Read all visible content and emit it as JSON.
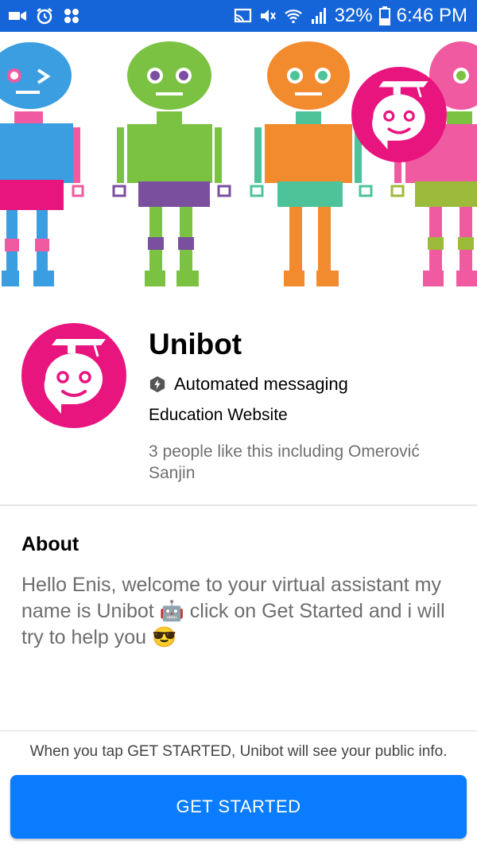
{
  "status_bar": {
    "battery": "32%",
    "time": "6:46 PM",
    "bg_color": "#1565d8"
  },
  "page": {
    "name": "Unibot",
    "verified_label": "Automated messaging",
    "category": "Education Website",
    "likes": "3 people like this including Omerović Sanjin"
  },
  "about": {
    "title": "About",
    "text": "Hello Enis, welcome to your virtual assistant my name is Unibot 🤖 click on  Get Started and i will try to help you 😎"
  },
  "footer": {
    "note": "When you tap GET STARTED, Unibot will see your public info.",
    "button_label": "GET STARTED",
    "button_color": "#0a7cff"
  },
  "colors": {
    "brand_pink": "#e8157f",
    "robot_blue": "#3b9ee0",
    "robot_green": "#7cc242",
    "robot_orange": "#f28a2e",
    "robot_purple": "#7a4f9e",
    "robot_teal": "#4ec39a",
    "robot_pink": "#ef5aa0"
  }
}
